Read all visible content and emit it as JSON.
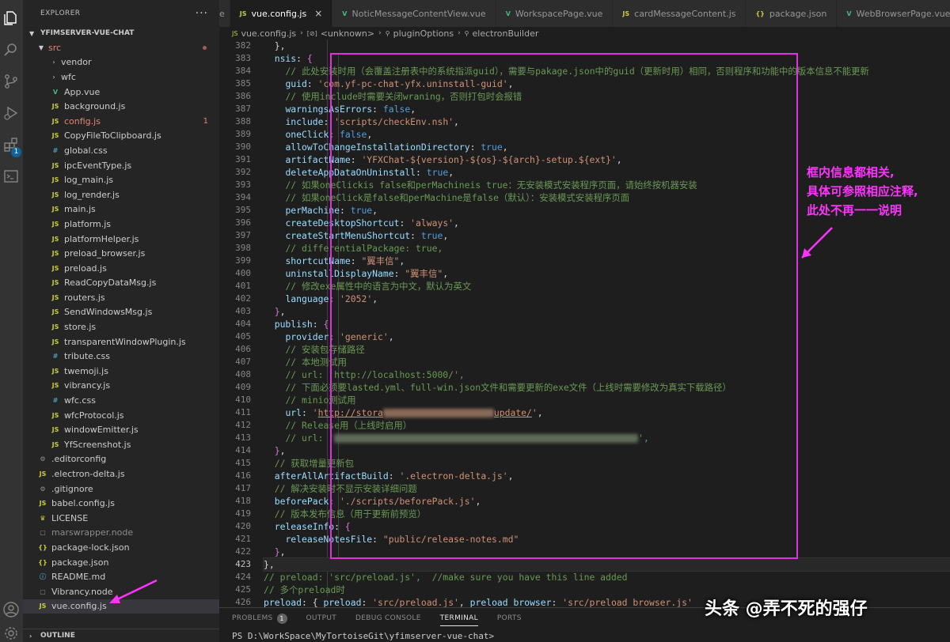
{
  "sidebar": {
    "title": "EXPLORER",
    "more": "···",
    "root": "YFIMSERVER-VUE-CHAT",
    "outline": "OUTLINE",
    "badge": "1",
    "tree": [
      {
        "label": "src",
        "icon": "chevron",
        "indent": 1,
        "folder": true,
        "open": true,
        "modified": true,
        "dot": true
      },
      {
        "label": "vendor",
        "icon": "chevron",
        "indent": 2,
        "folder": true
      },
      {
        "label": "wfc",
        "icon": "chevron",
        "indent": 2,
        "folder": true
      },
      {
        "label": "App.vue",
        "icon": "vue",
        "indent": 2
      },
      {
        "label": "background.js",
        "icon": "js",
        "indent": 2
      },
      {
        "label": "config.js",
        "icon": "js",
        "indent": 2,
        "modified": true,
        "count": "1"
      },
      {
        "label": "CopyFileToClipboard.js",
        "icon": "js",
        "indent": 2
      },
      {
        "label": "global.css",
        "icon": "css",
        "indent": 2
      },
      {
        "label": "ipcEventType.js",
        "icon": "js",
        "indent": 2
      },
      {
        "label": "log_main.js",
        "icon": "js",
        "indent": 2
      },
      {
        "label": "log_render.js",
        "icon": "js",
        "indent": 2
      },
      {
        "label": "main.js",
        "icon": "js",
        "indent": 2
      },
      {
        "label": "platform.js",
        "icon": "js",
        "indent": 2
      },
      {
        "label": "platformHelper.js",
        "icon": "js",
        "indent": 2
      },
      {
        "label": "preload_browser.js",
        "icon": "js",
        "indent": 2
      },
      {
        "label": "preload.js",
        "icon": "js",
        "indent": 2
      },
      {
        "label": "ReadCopyDataMsg.js",
        "icon": "js",
        "indent": 2
      },
      {
        "label": "routers.js",
        "icon": "js",
        "indent": 2
      },
      {
        "label": "SendWindowsMsg.js",
        "icon": "js",
        "indent": 2
      },
      {
        "label": "store.js",
        "icon": "js",
        "indent": 2
      },
      {
        "label": "transparentWindowPlugin.js",
        "icon": "js",
        "indent": 2
      },
      {
        "label": "tribute.css",
        "icon": "css",
        "indent": 2
      },
      {
        "label": "twemoji.js",
        "icon": "js",
        "indent": 2
      },
      {
        "label": "vibrancy.js",
        "icon": "js",
        "indent": 2
      },
      {
        "label": "wfc.css",
        "icon": "css",
        "indent": 2
      },
      {
        "label": "wfcProtocol.js",
        "icon": "js",
        "indent": 2
      },
      {
        "label": "windowEmitter.js",
        "icon": "js",
        "indent": 2
      },
      {
        "label": "YfScreenshot.js",
        "icon": "js",
        "indent": 2
      },
      {
        "label": ".editorconfig",
        "icon": "gear",
        "indent": 1
      },
      {
        "label": ".electron-delta.js",
        "icon": "js",
        "indent": 1
      },
      {
        "label": ".gitignore",
        "icon": "gear",
        "indent": 1
      },
      {
        "label": "babel.config.js",
        "icon": "js",
        "indent": 1
      },
      {
        "label": "LICENSE",
        "icon": "lic",
        "indent": 1
      },
      {
        "label": "marswrapper.node",
        "icon": "node",
        "indent": 1,
        "dim": true
      },
      {
        "label": "package-lock.json",
        "icon": "json",
        "indent": 1
      },
      {
        "label": "package.json",
        "icon": "json",
        "indent": 1
      },
      {
        "label": "README.md",
        "icon": "md",
        "indent": 1
      },
      {
        "label": "Vibrancy.node",
        "icon": "node",
        "indent": 1
      },
      {
        "label": "vue.config.js",
        "icon": "js",
        "indent": 1,
        "selected": true
      }
    ]
  },
  "tabs": [
    {
      "label": "e",
      "icon": "",
      "active": false,
      "partial": true
    },
    {
      "label": "vue.config.js",
      "icon": "js",
      "active": true
    },
    {
      "label": "NoticMessageContentView.vue",
      "icon": "vue",
      "active": false
    },
    {
      "label": "WorkspacePage.vue",
      "icon": "vue",
      "active": false
    },
    {
      "label": "cardMessageContent.js",
      "icon": "js",
      "active": false
    },
    {
      "label": "package.json",
      "icon": "json",
      "active": false
    },
    {
      "label": "WebBrowserPage.vue",
      "icon": "vue",
      "active": false
    }
  ],
  "tab_close": "×",
  "breadcrumb": [
    {
      "label": "vue.config.js",
      "icon": "JS"
    },
    {
      "label": "<unknown>",
      "icon": "[⊘]"
    },
    {
      "label": "pluginOptions",
      "icon": "⚲"
    },
    {
      "label": "electronBuilder",
      "icon": "⚲"
    }
  ],
  "editor": {
    "first_line": 382,
    "current_line": 423,
    "lines": [
      [
        [
          "  ",
          ""
        ],
        [
          "},",
          "p"
        ]
      ],
      [
        [
          "  ",
          ""
        ],
        [
          "nsis",
          "k"
        ],
        [
          ": ",
          "p"
        ],
        [
          "{",
          "br"
        ]
      ],
      [
        [
          "    ",
          ""
        ],
        [
          "// 此处安装时用（会覆盖注册表中的系统指派guid），需要与pakage.json中的guid（更新时用）相同，否则程序和功能中的版本信息不能更新",
          "c"
        ]
      ],
      [
        [
          "    ",
          ""
        ],
        [
          "guid",
          "k"
        ],
        [
          ": ",
          "p"
        ],
        [
          "'com.yf-pc-chat-yfx.uninstall-guid'",
          "s"
        ],
        [
          ",",
          "p"
        ]
      ],
      [
        [
          "    ",
          ""
        ],
        [
          "// 使用include时需要关闭wraning，否则打包时会报错",
          "c"
        ]
      ],
      [
        [
          "    ",
          ""
        ],
        [
          "warningsAsErrors",
          "k"
        ],
        [
          ": ",
          "p"
        ],
        [
          "false",
          "b"
        ],
        [
          ",",
          "p"
        ]
      ],
      [
        [
          "    ",
          ""
        ],
        [
          "include",
          "k"
        ],
        [
          ": ",
          "p"
        ],
        [
          "'scripts/checkEnv.nsh'",
          "s"
        ],
        [
          ",",
          "p"
        ]
      ],
      [
        [
          "    ",
          ""
        ],
        [
          "oneClick",
          "k"
        ],
        [
          ": ",
          "p"
        ],
        [
          "false",
          "b"
        ],
        [
          ",",
          "p"
        ]
      ],
      [
        [
          "    ",
          ""
        ],
        [
          "allowToChangeInstallationDirectory",
          "k"
        ],
        [
          ": ",
          "p"
        ],
        [
          "true",
          "b"
        ],
        [
          ",",
          "p"
        ]
      ],
      [
        [
          "    ",
          ""
        ],
        [
          "artifactName",
          "k"
        ],
        [
          ": ",
          "p"
        ],
        [
          "'YFXChat-${version}-${os}-${arch}-setup.${ext}'",
          "s"
        ],
        [
          ",",
          "p"
        ]
      ],
      [
        [
          "    ",
          ""
        ],
        [
          "deleteAppDataOnUninstall",
          "k"
        ],
        [
          ": ",
          "p"
        ],
        [
          "true",
          "b"
        ],
        [
          ",",
          "p"
        ]
      ],
      [
        [
          "    ",
          ""
        ],
        [
          "// 如果oneClickis false和perMachineis true：无安装模式安装程序页面，请始终按机器安装",
          "c"
        ]
      ],
      [
        [
          "    ",
          ""
        ],
        [
          "// 如果oneClick是false和perMachine是false（默认）：安装模式安装程序页面",
          "c"
        ]
      ],
      [
        [
          "    ",
          ""
        ],
        [
          "perMachine",
          "k"
        ],
        [
          ": ",
          "p"
        ],
        [
          "true",
          "b"
        ],
        [
          ",",
          "p"
        ]
      ],
      [
        [
          "    ",
          ""
        ],
        [
          "createDesktopShortcut",
          "k"
        ],
        [
          ": ",
          "p"
        ],
        [
          "'always'",
          "s"
        ],
        [
          ",",
          "p"
        ]
      ],
      [
        [
          "    ",
          ""
        ],
        [
          "createStartMenuShortcut",
          "k"
        ],
        [
          ": ",
          "p"
        ],
        [
          "true",
          "b"
        ],
        [
          ",",
          "p"
        ]
      ],
      [
        [
          "    ",
          ""
        ],
        [
          "// differentialPackage: true,",
          "c"
        ]
      ],
      [
        [
          "    ",
          ""
        ],
        [
          "shortcutName",
          "k"
        ],
        [
          ": ",
          "p"
        ],
        [
          "\"翼丰信\"",
          "s"
        ],
        [
          ",",
          "p"
        ]
      ],
      [
        [
          "    ",
          ""
        ],
        [
          "uninstallDisplayName",
          "k"
        ],
        [
          ": ",
          "p"
        ],
        [
          "\"翼丰信\"",
          "s"
        ],
        [
          ",",
          "p"
        ]
      ],
      [
        [
          "    ",
          ""
        ],
        [
          "// 修改exe属性中的语言为中文，默认为英文",
          "c"
        ]
      ],
      [
        [
          "    ",
          ""
        ],
        [
          "language",
          "k"
        ],
        [
          ": ",
          "p"
        ],
        [
          "'2052'",
          "s"
        ],
        [
          ",",
          "p"
        ]
      ],
      [
        [
          "  ",
          ""
        ],
        [
          "}",
          "br"
        ],
        [
          ",",
          "p"
        ]
      ],
      [
        [
          "  ",
          ""
        ],
        [
          "publish",
          "k"
        ],
        [
          ": ",
          "p"
        ],
        [
          "{",
          "br"
        ]
      ],
      [
        [
          "    ",
          ""
        ],
        [
          "provider",
          "k"
        ],
        [
          ": ",
          "p"
        ],
        [
          "'generic'",
          "s"
        ],
        [
          ",",
          "p"
        ]
      ],
      [
        [
          "    ",
          ""
        ],
        [
          "// 安装包存储路径",
          "c"
        ]
      ],
      [
        [
          "    ",
          ""
        ],
        [
          "// 本地测试用",
          "c"
        ]
      ],
      [
        [
          "    ",
          ""
        ],
        [
          "// url: 'http://localhost:5000/',",
          "c"
        ]
      ],
      [
        [
          "    ",
          ""
        ],
        [
          "// 下面必须要lasted.yml、full-win.json文件和需要更新的exe文件（上线时需要修改为真实下载路径）",
          "c"
        ]
      ],
      [
        [
          "    ",
          ""
        ],
        [
          "// minio测试用",
          "c"
        ]
      ],
      [
        [
          "    ",
          ""
        ],
        [
          "url",
          "k"
        ],
        [
          ": ",
          "p"
        ],
        [
          "'",
          "s"
        ],
        [
          "http://stora",
          "u"
        ],
        [
          "",
          "blur1"
        ],
        [
          "update/",
          "u"
        ],
        [
          "'",
          "s"
        ],
        [
          ",",
          "p"
        ]
      ],
      [
        [
          "    ",
          ""
        ],
        [
          "// Release用（上线时启用）",
          "c"
        ]
      ],
      [
        [
          "    ",
          ""
        ],
        [
          "// url: '",
          "c"
        ],
        [
          "",
          "blur2"
        ],
        [
          "',",
          "c"
        ]
      ],
      [
        [
          "  ",
          ""
        ],
        [
          "}",
          "br"
        ],
        [
          ",",
          "p"
        ]
      ],
      [
        [
          "  ",
          ""
        ],
        [
          "// 获取增量更新包",
          "c"
        ]
      ],
      [
        [
          "  ",
          ""
        ],
        [
          "afterAllArtifactBuild",
          "k"
        ],
        [
          ": ",
          "p"
        ],
        [
          "'.electron-delta.js'",
          "s"
        ],
        [
          ",",
          "p"
        ]
      ],
      [
        [
          "  ",
          ""
        ],
        [
          "// 解决安装时不显示安装详细问题",
          "c"
        ]
      ],
      [
        [
          "  ",
          ""
        ],
        [
          "beforePack",
          "k"
        ],
        [
          ": ",
          "p"
        ],
        [
          "'./scripts/beforePack.js'",
          "s"
        ],
        [
          ",",
          "p"
        ]
      ],
      [
        [
          "  ",
          ""
        ],
        [
          "// 版本发布信息（用于更新前预览）",
          "c"
        ]
      ],
      [
        [
          "  ",
          ""
        ],
        [
          "releaseInfo",
          "k"
        ],
        [
          ": ",
          "p"
        ],
        [
          "{",
          "br"
        ]
      ],
      [
        [
          "    ",
          ""
        ],
        [
          "releaseNotesFile",
          "k"
        ],
        [
          ": ",
          "p"
        ],
        [
          "\"public/release-notes.md\"",
          "s"
        ]
      ],
      [
        [
          "  ",
          ""
        ],
        [
          "}",
          "br"
        ],
        [
          ",",
          "p"
        ]
      ],
      [
        [
          "",
          ""
        ],
        [
          "},",
          "p"
        ]
      ],
      [
        [
          "",
          ""
        ],
        [
          "// preload: 'src/preload.js',  //make sure you have this line added",
          "c"
        ]
      ],
      [
        [
          "",
          ""
        ],
        [
          "// 多个preload时",
          "c"
        ]
      ],
      [
        [
          "",
          ""
        ],
        [
          "preload",
          "k"
        ],
        [
          ": ",
          "p"
        ],
        [
          "{ ",
          "p"
        ],
        [
          "preload",
          "k"
        ],
        [
          ": ",
          "p"
        ],
        [
          "'src/preload.js'",
          "s"
        ],
        [
          ", ",
          "p"
        ],
        [
          "preload_browser",
          "k"
        ],
        [
          ": ",
          "p"
        ],
        [
          "'src/preload_browser.js'",
          "s"
        ]
      ]
    ]
  },
  "annotation": {
    "lines": [
      "框内信息都相关,",
      "具体可参照相应注释,",
      "此处不再一一说明"
    ],
    "color": "#ff33ff"
  },
  "panel": {
    "tabs": [
      {
        "label": "PROBLEMS",
        "badge": "1",
        "active": false
      },
      {
        "label": "OUTPUT",
        "active": false
      },
      {
        "label": "DEBUG CONSOLE",
        "active": false
      },
      {
        "label": "TERMINAL",
        "active": true
      },
      {
        "label": "PORTS",
        "active": false
      }
    ],
    "terminal_line": "PS D:\\WorkSpace\\MyTortoiseGit\\yfimserver-vue-chat>"
  },
  "watermark": "头条 @弄不死的强仔",
  "colors": {
    "accent": "#e030e0",
    "string": "#ce9178",
    "keyword": "#9cdcfe",
    "boolean": "#569cd6",
    "comment": "#6a9955"
  }
}
